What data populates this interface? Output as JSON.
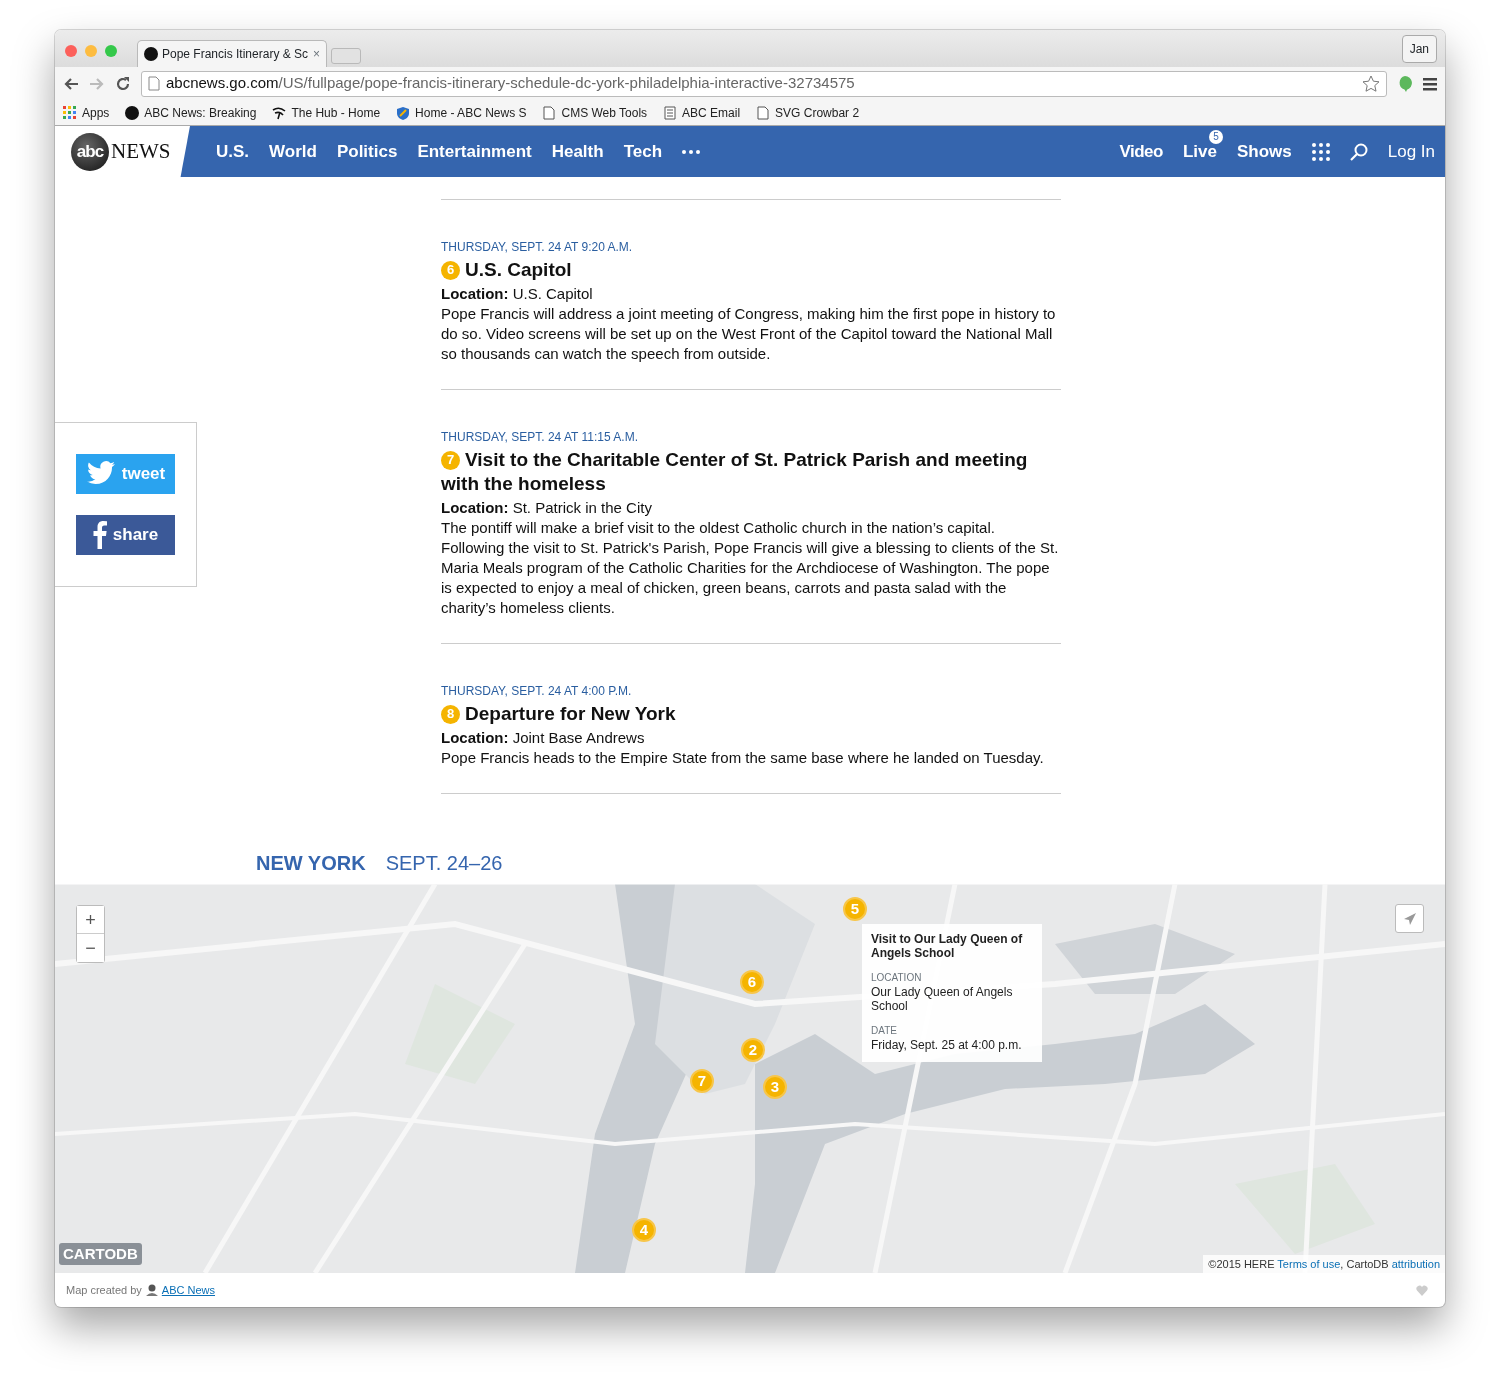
{
  "browser": {
    "tab_title": "Pope Francis Itinerary & Sc",
    "tab_close": "×",
    "profile": "Jan",
    "url_host": "abcnews.go.com",
    "url_path": "/US/fullpage/pope-francis-itinerary-schedule-dc-york-philadelphia-interactive-32734575",
    "bookmarks": [
      {
        "label": "Apps",
        "kind": "apps"
      },
      {
        "label": "ABC News: Breaking",
        "kind": "abc"
      },
      {
        "label": "The Hub - Home",
        "kind": "hub"
      },
      {
        "label": "Home - ABC News S",
        "kind": "shield"
      },
      {
        "label": "CMS Web Tools",
        "kind": "page"
      },
      {
        "label": "ABC Email",
        "kind": "doc"
      },
      {
        "label": "SVG Crowbar 2",
        "kind": "page"
      }
    ]
  },
  "nav": {
    "logo_mark": "abc",
    "logo_word": "NEWS",
    "sections": [
      "U.S.",
      "World",
      "Politics",
      "Entertainment",
      "Health",
      "Tech"
    ],
    "right": [
      {
        "label": "Video",
        "kind": "link"
      },
      {
        "label": "Live",
        "kind": "live",
        "badge": "5"
      },
      {
        "label": "Shows",
        "kind": "link"
      },
      {
        "kind": "grid"
      },
      {
        "kind": "search"
      },
      {
        "label": "Log In",
        "kind": "login"
      }
    ]
  },
  "social": [
    {
      "label": "tweet",
      "kind": "twitter"
    },
    {
      "label": "share",
      "kind": "facebook"
    }
  ],
  "events": [
    {
      "date": "THURSDAY, SEPT. 24 AT 9:20 A.M.",
      "number": "6",
      "title": "U.S. Capitol",
      "location_label": "Location:",
      "location": "U.S. Capitol",
      "description": "Pope Francis will address a joint meeting of Congress, making him the first pope in history to do so. Video screens will be set up on the West Front of the Capitol toward the National Mall so thousands can watch the speech from outside."
    },
    {
      "date": "THURSDAY, SEPT. 24 AT 11:15 A.M.",
      "number": "7",
      "title": "Visit to the Charitable Center of St. Patrick Parish and meeting with the homeless",
      "location_label": "Location:",
      "location": "St. Patrick in the City",
      "description": "The pontiff will make a brief visit to the oldest Catholic church in the nation’s capital. Following the visit to St. Patrick's Parish, Pope Francis will give a blessing to clients of the St. Maria Meals program of the Catholic Charities for the Archdiocese of Washington. The pope is expected to enjoy a meal of chicken, green beans, carrots and pasta salad with the charity’s homeless clients."
    },
    {
      "date": "THURSDAY, SEPT. 24 AT 4:00 P.M.",
      "number": "8",
      "title": "Departure for New York",
      "location_label": "Location:",
      "location": "Joint Base Andrews",
      "description": "Pope Francis heads to the Empire State from the same base where he landed on Tuesday."
    }
  ],
  "city_heading": {
    "city": "NEW YORK",
    "dates": "SEPT. 24–26"
  },
  "map": {
    "kind": "picture",
    "zoom_in": "+",
    "zoom_out": "−",
    "markers": [
      "5",
      "6",
      "2",
      "7",
      "3",
      "4"
    ],
    "popup": {
      "title": "Visit to Our Lady Queen of Angels School",
      "location_label": "LOCATION",
      "location": "Our Lady Queen of Angels School",
      "date_label": "DATE",
      "date": "Friday, Sept. 25 at 4:00 p.m."
    },
    "logo": "CARTODB",
    "attribution_prefix": "©2015 HERE",
    "terms_link": "Terms of use",
    "attribution_mid": ", CartoDB",
    "attribution_link": "attribution"
  },
  "footer": {
    "credit": "Map created by",
    "credit_link": "ABC News"
  }
}
